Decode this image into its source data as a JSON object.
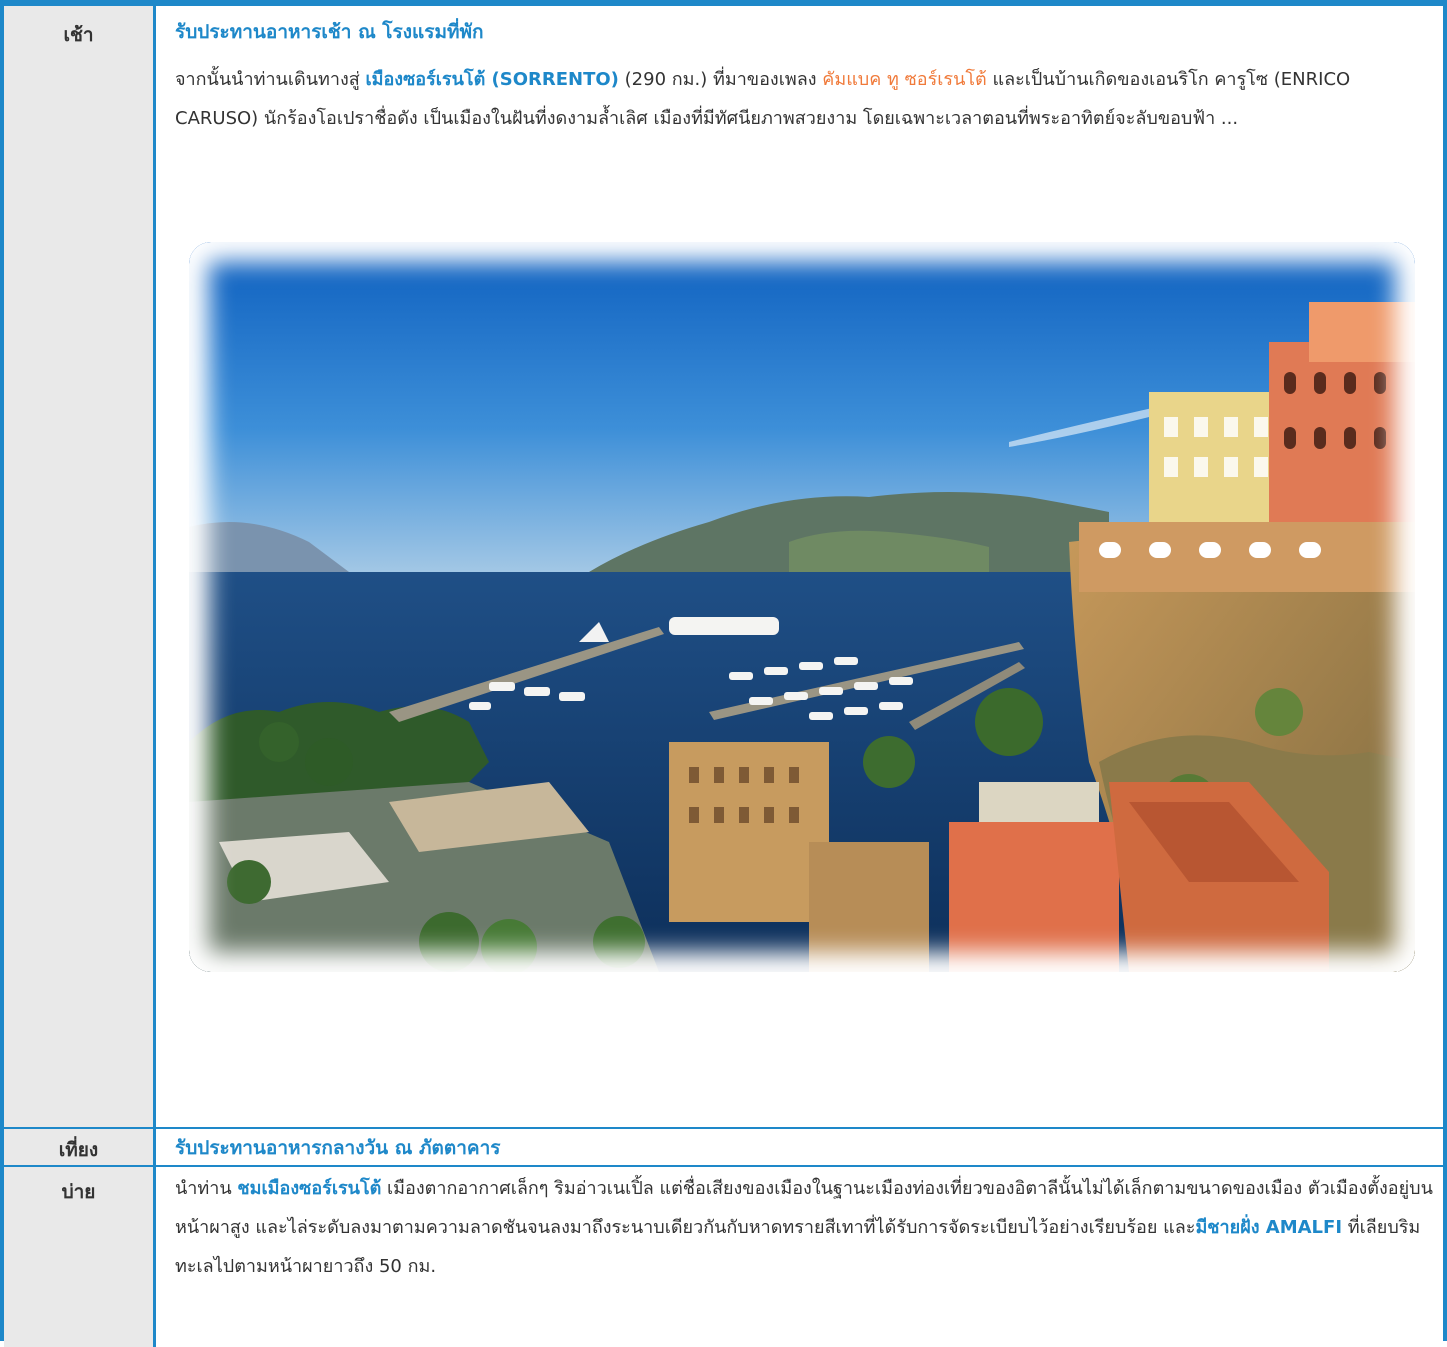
{
  "rows": [
    {
      "time": "เช้า",
      "heading": "รับประทานอาหารเช้า ณ โรงแรมที่พัก",
      "para": {
        "t1": "จากนั้นนำท่านเดินทางสู่ ",
        "b1": "เมืองซอร์เรนโต้  (SORRENTO)",
        "t2": " (290 กม.) ที่มาของเพลง ",
        "o1": "คัมแบค ทู ซอร์เรนโต้",
        "t3": " และเป็นบ้านเกิดของเอนริโก คารูโซ (ENRICO CARUSO)  นักร้องโอเปราชื่อดัง เป็นเมืองในฝันที่งดงามล้ำเลิศ เมืองที่มีทัศนียภาพสวยงาม โดยเฉพาะเวลาตอนที่พระอาทิตย์จะลับขอบฟ้า ..."
      },
      "photo": "photo"
    },
    {
      "time": "เที่ยง",
      "heading": "รับประทานอาหารกลางวัน ณ ภัตตาคาร"
    },
    {
      "time": "บ่าย",
      "para": {
        "t1": "นำท่าน ",
        "b1": "ชมเมืองซอร์เรนโต้",
        "t2": "  เมืองตากอากาศเล็กๆ ริมอ่าวเนเปิ้ล แต่ชื่อเสียงของเมืองในฐานะเมืองท่องเที่ยวของอิตาลีนั้นไม่ได้เล็กตามขนาดของเมือง ตัวเมืองตั้งอยู่บนหน้าผาสูง และไล่ระดับลงมาตามความลาดชันจนลงมาถึงระนาบเดียวกันกับหาดทรายสีเทาที่ได้รับการจัดระเบียบไว้อย่างเรียบร้อย และ",
        "b2": "มีชายฝั่ง AMALFI",
        "t3": " ที่เลียบริมทะเลไปตามหน้าผายาวถึง 50 กม."
      }
    }
  ],
  "colors": {
    "accent": "#1e88c9",
    "highlight": "#f07a3a",
    "time_cell_bg": "#e9e9e9"
  }
}
